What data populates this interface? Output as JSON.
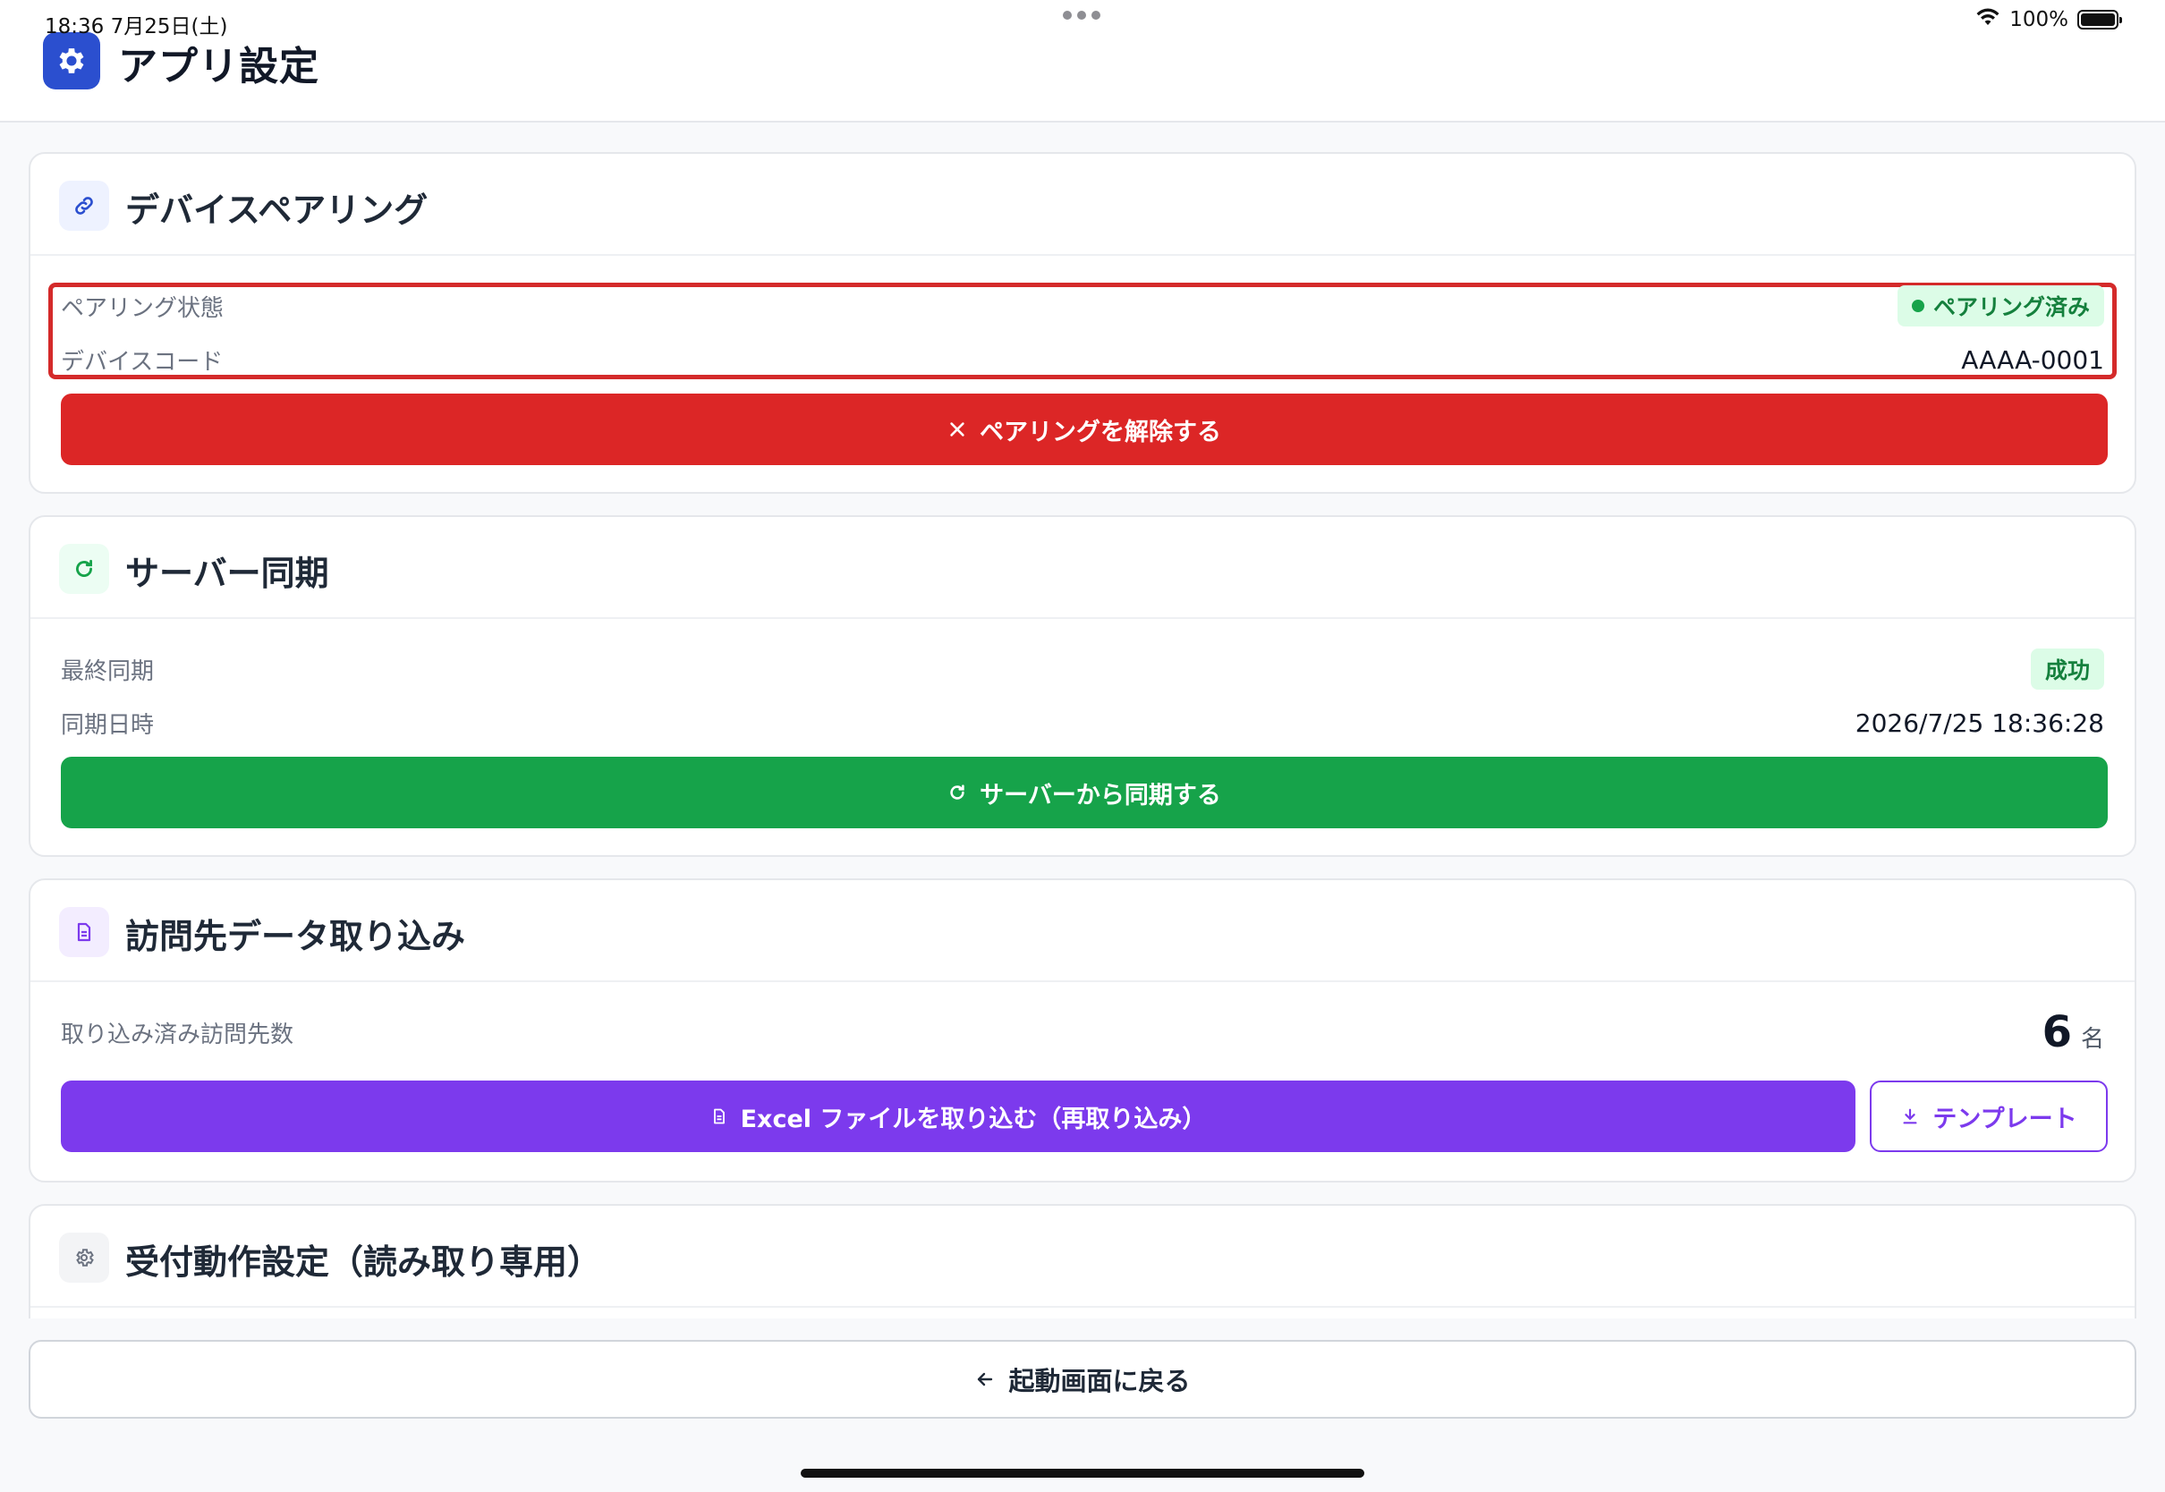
{
  "status_bar": {
    "time_date": "18:36  7月25日(土)",
    "battery": "100%"
  },
  "header": {
    "title": "アプリ設定",
    "icon": "gear-icon"
  },
  "pairing": {
    "title": "デバイスペアリング",
    "icon": "link-icon",
    "status_label": "ペアリング状態",
    "status_value": "ペアリング済み",
    "code_label": "デバイスコード",
    "code_value": "AAAA-0001",
    "unpair_button": "ペアリングを解除する"
  },
  "sync": {
    "title": "サーバー同期",
    "icon": "refresh-icon",
    "last_label": "最終同期",
    "last_value": "成功",
    "time_label": "同期日時",
    "time_value": "2026/7/25 18:36:28",
    "sync_button": "サーバーから同期する"
  },
  "import": {
    "title": "訪問先データ取り込み",
    "icon": "document-icon",
    "count_label": "取り込み済み訪問先数",
    "count_value": "6",
    "count_unit": "名",
    "import_button": "Excel ファイルを取り込む（再取り込み）",
    "template_button": "テンプレート"
  },
  "reception": {
    "title": "受付動作設定（読み取り専用）",
    "icon": "gear-icon"
  },
  "footer": {
    "back_button": "起動画面に戻る"
  },
  "colors": {
    "primary": "#2b4fcf",
    "danger": "#dc2626",
    "success": "#16a34a",
    "purple": "#7c3aed",
    "highlight": "#d42a2a"
  }
}
